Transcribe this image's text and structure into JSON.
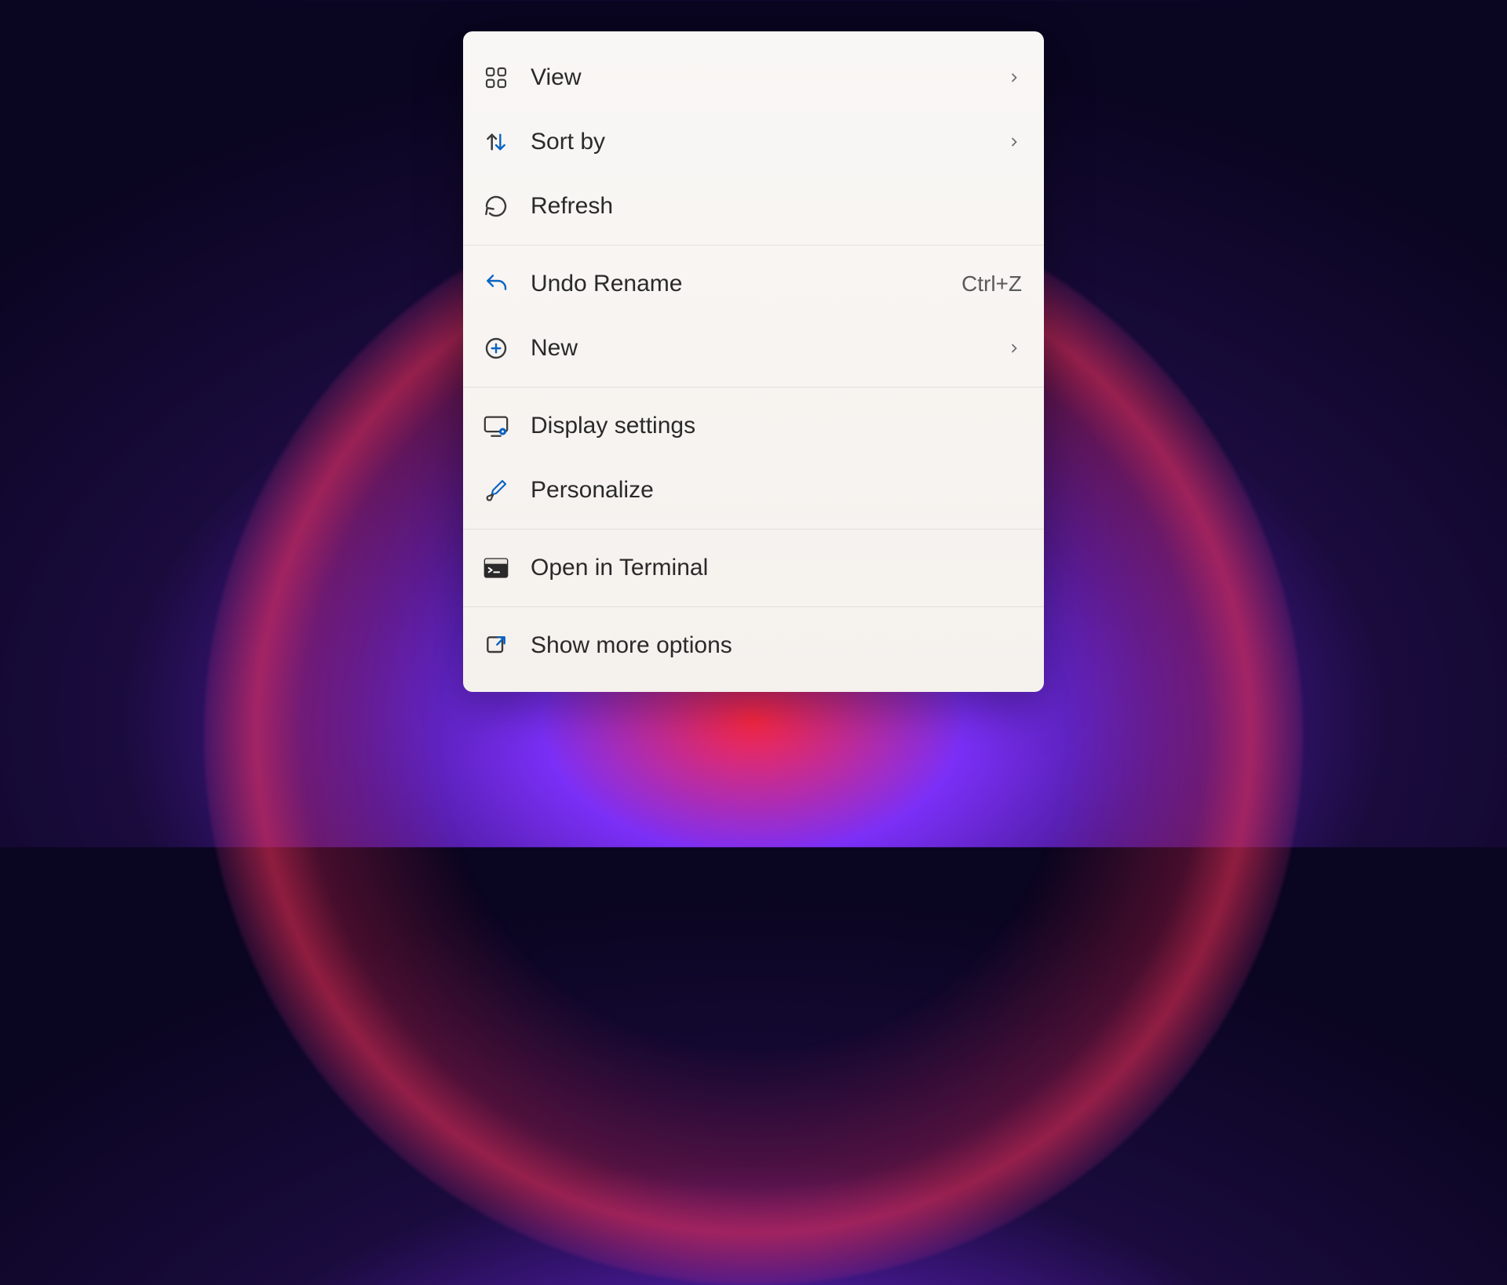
{
  "context_menu": {
    "groups": [
      {
        "items": [
          {
            "id": "view",
            "label": "View",
            "icon": "view-grid-icon",
            "has_submenu": true
          },
          {
            "id": "sort-by",
            "label": "Sort by",
            "icon": "sort-icon",
            "has_submenu": true
          },
          {
            "id": "refresh",
            "label": "Refresh",
            "icon": "refresh-icon"
          }
        ]
      },
      {
        "items": [
          {
            "id": "undo-rename",
            "label": "Undo Rename",
            "icon": "undo-icon",
            "shortcut": "Ctrl+Z"
          },
          {
            "id": "new",
            "label": "New",
            "icon": "plus-circle-icon",
            "has_submenu": true
          }
        ]
      },
      {
        "items": [
          {
            "id": "display-settings",
            "label": "Display settings",
            "icon": "display-settings-icon"
          },
          {
            "id": "personalize",
            "label": "Personalize",
            "icon": "paintbrush-icon"
          }
        ]
      },
      {
        "items": [
          {
            "id": "open-terminal",
            "label": "Open in Terminal",
            "icon": "terminal-icon"
          }
        ]
      },
      {
        "items": [
          {
            "id": "show-more-options",
            "label": "Show more options",
            "icon": "show-more-icon"
          }
        ]
      }
    ]
  },
  "colors": {
    "accent": "#0a63c2"
  }
}
